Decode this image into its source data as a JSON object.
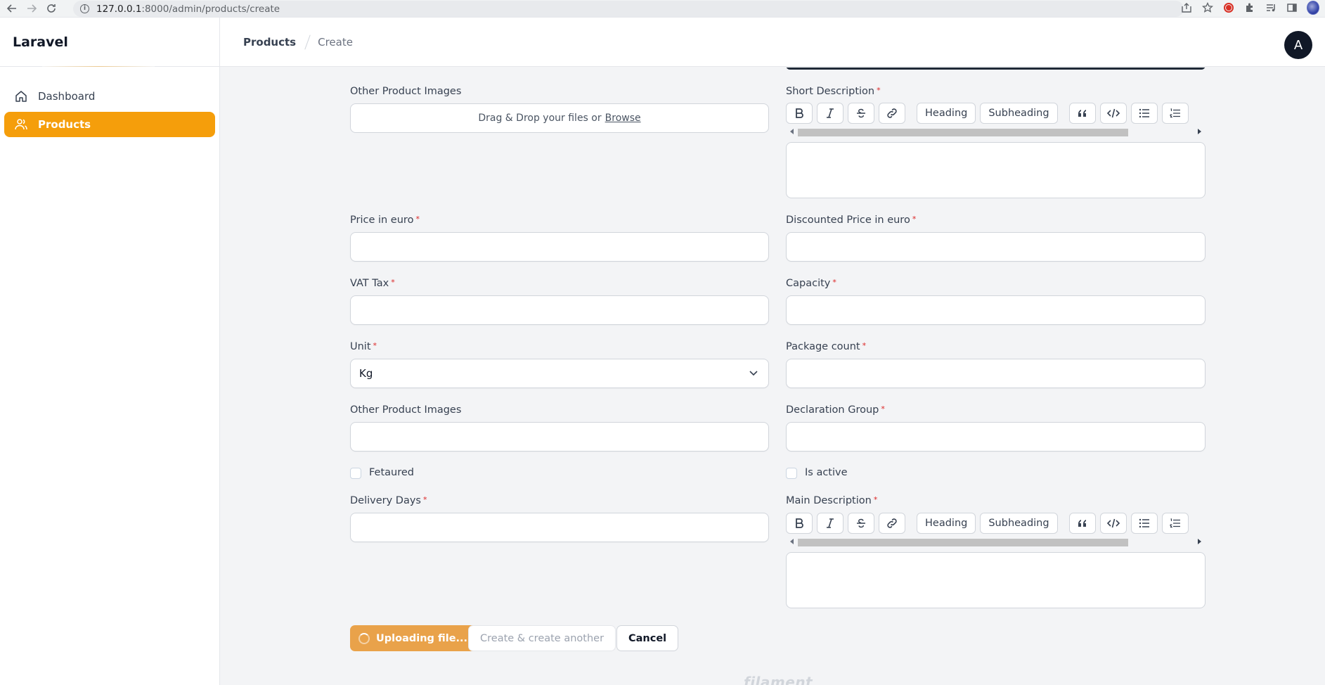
{
  "browser": {
    "url_host": "127.0.0.1",
    "url_path": ":8000/admin/products/create"
  },
  "sidebar": {
    "brand": "Laravel",
    "items": [
      {
        "label": "Dashboard",
        "icon": "home-icon"
      },
      {
        "label": "Products",
        "icon": "users-icon",
        "active": true
      }
    ]
  },
  "topbar": {
    "breadcrumb": [
      "Products",
      "Create"
    ],
    "avatar_initial": "A"
  },
  "form": {
    "other_images_1": {
      "label": "Other Product Images",
      "dropzone_text": "Drag & Drop your files or",
      "browse_label": "Browse"
    },
    "short_description": {
      "label": "Short Description",
      "required_mark": "*"
    },
    "price": {
      "label": "Price in euro",
      "required_mark": "*",
      "value": ""
    },
    "discounted_price": {
      "label": "Discounted Price in euro",
      "required_mark": "*",
      "value": ""
    },
    "vat_tax": {
      "label": "VAT Tax",
      "required_mark": "*",
      "value": ""
    },
    "capacity": {
      "label": "Capacity",
      "required_mark": "*",
      "value": ""
    },
    "unit": {
      "label": "Unit",
      "required_mark": "*",
      "selected": "Kg"
    },
    "package_count": {
      "label": "Package count",
      "required_mark": "*",
      "value": ""
    },
    "other_images_2": {
      "label": "Other Product Images",
      "value": ""
    },
    "declaration_group": {
      "label": "Declaration Group",
      "required_mark": "*",
      "value": ""
    },
    "featured": {
      "label": "Fetaured",
      "checked": false
    },
    "is_active": {
      "label": "Is active",
      "checked": false
    },
    "delivery_days": {
      "label": "Delivery Days",
      "required_mark": "*",
      "value": ""
    },
    "main_description": {
      "label": "Main Description",
      "required_mark": "*"
    }
  },
  "editor_toolbar": {
    "heading": "Heading",
    "subheading": "Subheading",
    "tools": [
      "bold-icon",
      "italic-icon",
      "strike-icon",
      "link-icon",
      "quote-icon",
      "code-icon",
      "bullet-list-icon",
      "ordered-list-icon"
    ]
  },
  "actions": {
    "primary": "Uploading file...",
    "create_another": "Create & create another",
    "cancel": "Cancel"
  },
  "footer": {
    "watermark": "filament"
  },
  "colors": {
    "accent": "#f59e0b",
    "accent_loading": "#e9a24a",
    "required": "#dc2626",
    "avatar_bg": "#111827"
  }
}
